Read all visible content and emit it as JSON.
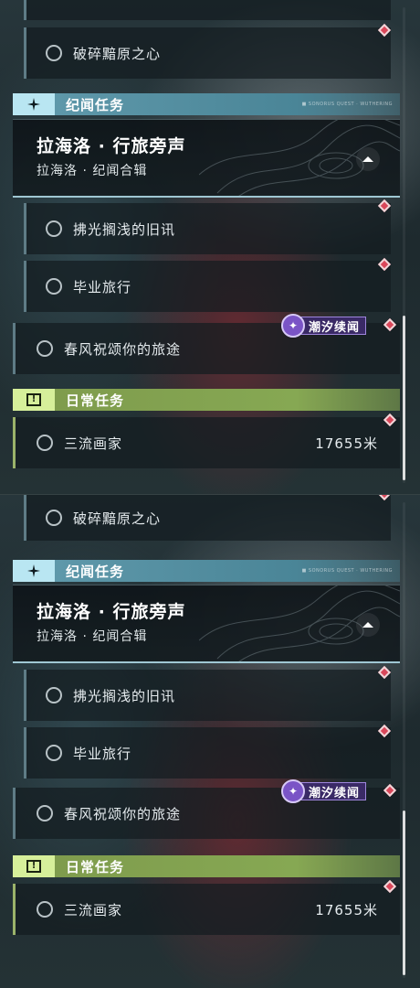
{
  "panels": [
    {
      "quests_top": {
        "label": "破碎黯原之心"
      },
      "story_section": {
        "title": "纪闻任务",
        "deco_text": "■ SONORUS QUEST · WUTHERING"
      },
      "story_card": {
        "title": "拉海洛 · 行旅旁声",
        "subtitle": "拉海洛 · 纪闻合辑"
      },
      "story_quests": [
        {
          "label": "拂光搁浅的旧讯"
        },
        {
          "label": "毕业旅行"
        },
        {
          "label": "春风祝颂你的旅途"
        }
      ],
      "tide_badge": {
        "label": "潮汐续闻"
      },
      "daily_section": {
        "title": "日常任务"
      },
      "daily_quest": {
        "label": "三流画家",
        "distance": "17655米"
      }
    },
    {
      "quests_top": {
        "label": "破碎黯原之心"
      },
      "story_section": {
        "title": "纪闻任务",
        "deco_text": "■ SONORUS QUEST · WUTHERING"
      },
      "story_card": {
        "title": "拉海洛 · 行旅旁声",
        "subtitle": "拉海洛 · 纪闻合辑"
      },
      "story_quests": [
        {
          "label": "拂光搁浅的旧讯"
        },
        {
          "label": "毕业旅行"
        },
        {
          "label": "春风祝颂你的旅途"
        }
      ],
      "tide_badge": {
        "label": "潮汐续闻"
      },
      "daily_section": {
        "title": "日常任务"
      },
      "daily_quest": {
        "label": "三流画家",
        "distance": "17655米"
      }
    }
  ],
  "colors": {
    "story_accent": "#5e98aa",
    "daily_accent": "#86a853",
    "tracker_marker": "#d9475a",
    "tide_badge": "#7a54c6"
  },
  "icons": {
    "story_section": "sparkle-icon",
    "daily_section": "alert-icon",
    "quest_status": "circle-icon",
    "tracker": "diamond-marker-icon",
    "collapse": "collapse-up-icon",
    "tide": "tide-swirl-icon"
  }
}
